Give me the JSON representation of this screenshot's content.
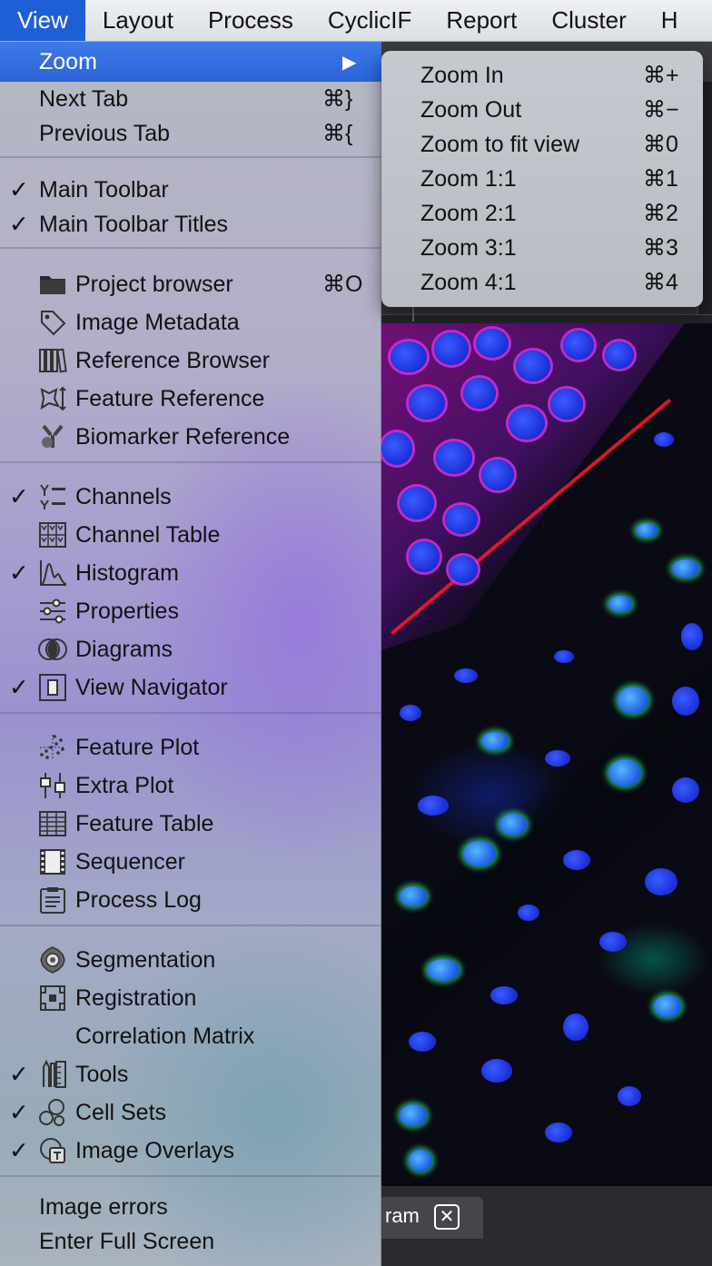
{
  "menubar": {
    "items": [
      "View",
      "Layout",
      "Process",
      "CyclicIF",
      "Report",
      "Cluster",
      "H"
    ],
    "active": "View"
  },
  "view_menu": {
    "zoom": {
      "label": "Zoom",
      "arrow": "▶"
    },
    "next_tab": {
      "label": "Next Tab",
      "shortcut": "⌘}"
    },
    "previous_tab": {
      "label": "Previous Tab",
      "shortcut": "⌘{"
    },
    "main_toolbar": {
      "label": "Main Toolbar",
      "checked": true
    },
    "main_toolbar_titles": {
      "label": "Main Toolbar Titles",
      "checked": true
    },
    "project_browser": {
      "label": "Project browser",
      "shortcut": "⌘O",
      "icon": "folder-icon"
    },
    "image_metadata": {
      "label": "Image Metadata",
      "icon": "tag-icon"
    },
    "reference_browser": {
      "label": "Reference Browser",
      "icon": "books-icon"
    },
    "feature_reference": {
      "label": "Feature Reference",
      "icon": "feature-reference-icon"
    },
    "biomarker_reference": {
      "label": "Biomarker Reference",
      "icon": "biomarker-icon"
    },
    "channels": {
      "label": "Channels",
      "checked": true,
      "icon": "channels-icon"
    },
    "channel_table": {
      "label": "Channel Table",
      "icon": "channel-table-icon"
    },
    "histogram": {
      "label": "Histogram",
      "checked": true,
      "icon": "histogram-icon"
    },
    "properties": {
      "label": "Properties",
      "icon": "sliders-icon"
    },
    "diagrams": {
      "label": "Diagrams",
      "icon": "venn-icon"
    },
    "view_navigator": {
      "label": "View Navigator",
      "checked": true,
      "icon": "navigator-icon"
    },
    "feature_plot": {
      "label": "Feature Plot",
      "icon": "scatter-plot-icon"
    },
    "extra_plot": {
      "label": "Extra Plot",
      "icon": "box-plot-icon"
    },
    "feature_table": {
      "label": "Feature Table",
      "icon": "table-icon"
    },
    "sequencer": {
      "label": "Sequencer",
      "icon": "film-icon"
    },
    "process_log": {
      "label": "Process Log",
      "icon": "clipboard-icon"
    },
    "segmentation": {
      "label": "Segmentation",
      "icon": "segmentation-icon"
    },
    "registration": {
      "label": "Registration",
      "icon": "registration-icon"
    },
    "correlation_matrix": {
      "label": "Correlation Matrix"
    },
    "tools": {
      "label": "Tools",
      "checked": true,
      "icon": "ruler-icon"
    },
    "cell_sets": {
      "label": "Cell Sets",
      "checked": true,
      "icon": "cell-sets-icon"
    },
    "image_overlays": {
      "label": "Image Overlays",
      "checked": true,
      "icon": "overlay-icon"
    },
    "image_errors": {
      "label": "Image errors"
    },
    "enter_full_screen": {
      "label": "Enter Full Screen"
    }
  },
  "zoom_submenu": [
    {
      "label": "Zoom In",
      "shortcut": "⌘+"
    },
    {
      "label": "Zoom Out",
      "shortcut": "⌘−"
    },
    {
      "label": "Zoom to fit view",
      "shortcut": "⌘0"
    },
    {
      "label": "Zoom 1:1",
      "shortcut": "⌘1"
    },
    {
      "label": "Zoom 2:1",
      "shortcut": "⌘2"
    },
    {
      "label": "Zoom 3:1",
      "shortcut": "⌘3"
    },
    {
      "label": "Zoom 4:1",
      "shortcut": "⌘4"
    }
  ],
  "check_glyph": "✓",
  "bottom_tab": {
    "label": "ram",
    "close": "✕"
  },
  "colors": {
    "highlight": "#2a63d6",
    "menubar_active": "#1f5fd6"
  }
}
